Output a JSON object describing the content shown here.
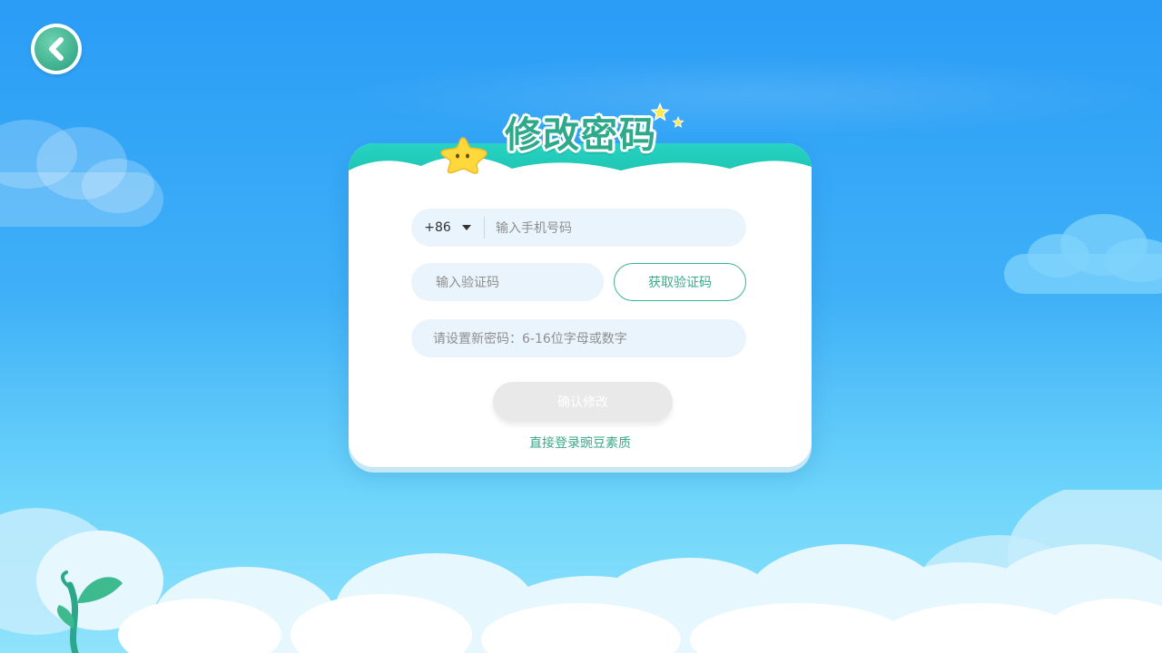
{
  "page": {
    "title": "修改密码"
  },
  "back_button": {
    "icon": "chevron-left-icon"
  },
  "form": {
    "country_code": "+86",
    "phone_placeholder": "输入手机号码",
    "code_placeholder": "输入验证码",
    "get_code_label": "获取验证码",
    "password_placeholder": "请设置新密码：6-16位字母或数字",
    "confirm_label": "确认修改",
    "direct_login_label": "直接登录豌豆素质"
  },
  "colors": {
    "accent": "#3aa98a",
    "header_teal": "#2ecbb6",
    "input_bg": "#eaf4fc",
    "disabled_button": "#e9e9e9"
  }
}
